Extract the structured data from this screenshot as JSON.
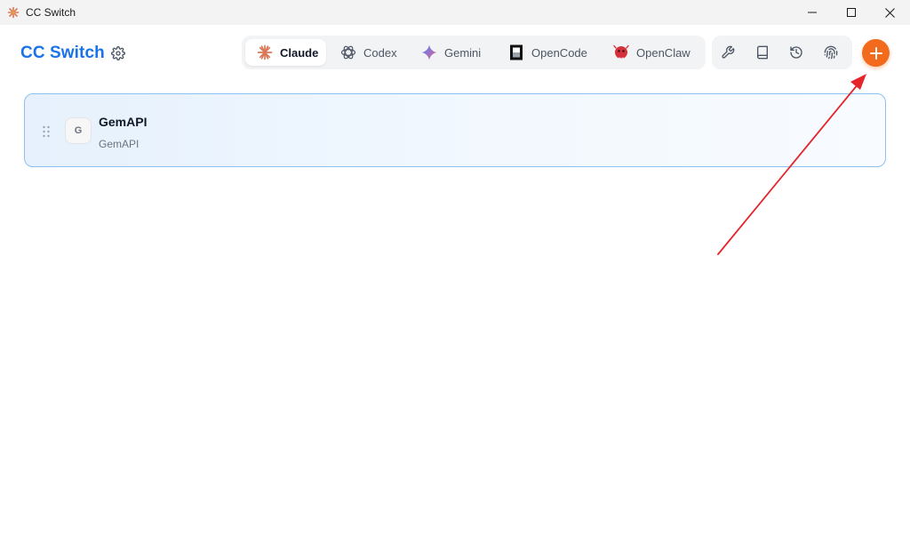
{
  "window": {
    "title": "CC Switch",
    "controls": [
      "minimize-icon",
      "maximize-icon",
      "close-icon"
    ]
  },
  "header": {
    "brand": "CC Switch",
    "settings_icon": "gear-icon"
  },
  "tabs": [
    {
      "label": "Claude",
      "icon": "claude-icon",
      "active": true
    },
    {
      "label": "Codex",
      "icon": "codex-icon",
      "active": false
    },
    {
      "label": "Gemini",
      "icon": "gemini-icon",
      "active": false
    },
    {
      "label": "OpenCode",
      "icon": "opencode-icon",
      "active": false
    },
    {
      "label": "OpenClaw",
      "icon": "openclaw-icon",
      "active": false
    }
  ],
  "tools": [
    "wrench-icon",
    "book-icon",
    "history-icon",
    "fingerprint-icon"
  ],
  "add_button": {
    "icon": "plus-icon",
    "color": "#f26a1b"
  },
  "providers": [
    {
      "avatar": "G",
      "name": "GemAPI",
      "subtitle": "GemAPI",
      "selected": true
    }
  ],
  "annotation": {
    "type": "red-arrow",
    "color": "#e5242b",
    "points_to": "add-button"
  },
  "colors": {
    "brand": "#1a73e8",
    "accent": "#f26a1b",
    "card_border": "#8ec0f2",
    "card_bg": "#e6f1fd"
  }
}
